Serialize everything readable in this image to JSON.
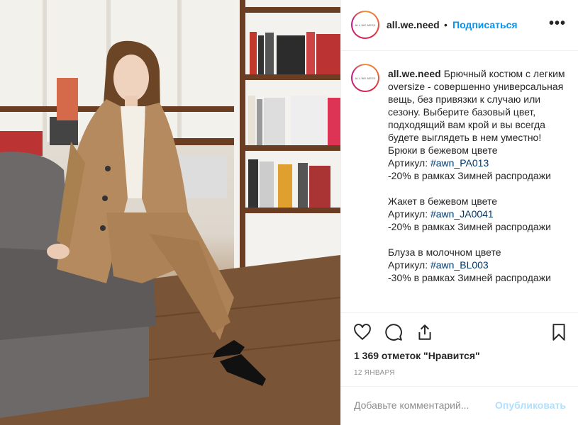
{
  "post": {
    "avatar_text": "ALL.WE.NEED",
    "username": "all.we.need",
    "dot": "•",
    "follow_label": "Подписаться",
    "more_label": "•••",
    "caption_lines": [
      "Брючный костюм с легким oversize - совершенно универсальная вещь, без привязки к случаю или сезону. Выберите базовый цвет, подходящий вам крой и вы всегда будете выглядеть в нем уместно!",
      "Брюки в бежевом цвете",
      "Артикул: ",
      "#awn_PA013",
      "-20% в рамках Зимней распродажи",
      "Жакет в бежевом цвете",
      "Артикул: ",
      "#awn_JA0041",
      "-20% в рамках Зимней распродажи",
      "Блуза в молочном цвете",
      "Артикул: ",
      "#awn_BL003",
      "-30% в рамках Зимней распродажи"
    ],
    "likes": "1 369 отметок \"Нравится\"",
    "date": "12 января",
    "comment_placeholder": "Добавьте комментарий...",
    "post_label": "Опубликовать"
  },
  "icons": [
    "heart-icon",
    "comment-icon",
    "share-icon",
    "bookmark-icon",
    "more-icon"
  ],
  "colors": {
    "link": "#0095f6",
    "hashtag": "#00376b",
    "muted": "#8e8e8e",
    "post_disabled": "#b2dffc"
  }
}
